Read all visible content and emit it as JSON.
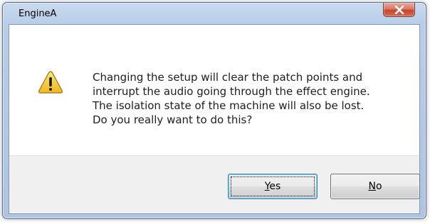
{
  "window": {
    "title": "EngineA"
  },
  "icons": {
    "close": "close-icon",
    "warning": "warning-icon"
  },
  "message": {
    "lines": [
      "Changing the setup will clear the patch points and",
      "interrupt the audio going through the effect engine.",
      "The isolation state of the machine will also be lost.",
      "Do you really want to do this?"
    ]
  },
  "buttons": {
    "yes": {
      "accel": "Y",
      "rest": "es"
    },
    "no": {
      "accel": "N",
      "rest": "o"
    }
  },
  "colors": {
    "close_button": "#c7452e",
    "warning_fill": "#f6c531",
    "default_button_border": "#3c7fb1"
  }
}
